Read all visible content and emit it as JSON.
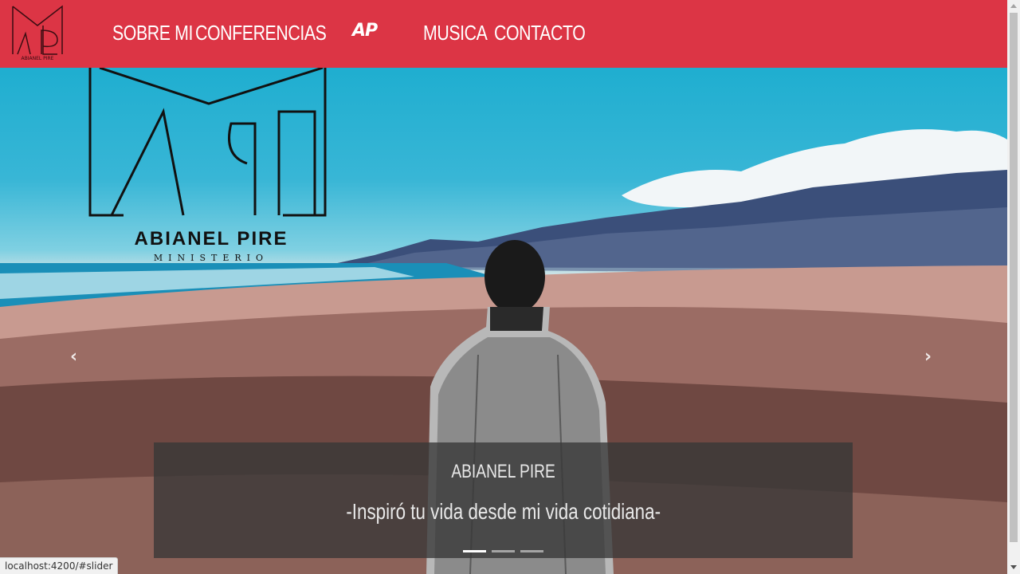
{
  "nav": {
    "logo_alt": "ABIANEL PIRE",
    "links": [
      "SOBRE MI",
      "CONFERENCIAS",
      "MUSICA",
      "CONTACTO"
    ],
    "center_mark": "AP",
    "background": "#dc3545"
  },
  "hero": {
    "brand_name": "ABIANEL PIRE",
    "brand_sub": "MINISTERIO",
    "caption_title": "ABIANEL PIRE",
    "caption_text": "-Inspiró tu vida desde mi vida cotidiana-",
    "indicators": [
      true,
      false,
      false
    ],
    "prev_icon": "chevron-left-icon",
    "next_icon": "chevron-right-icon"
  },
  "status_bar": {
    "url": "localhost:4200/#slider"
  }
}
